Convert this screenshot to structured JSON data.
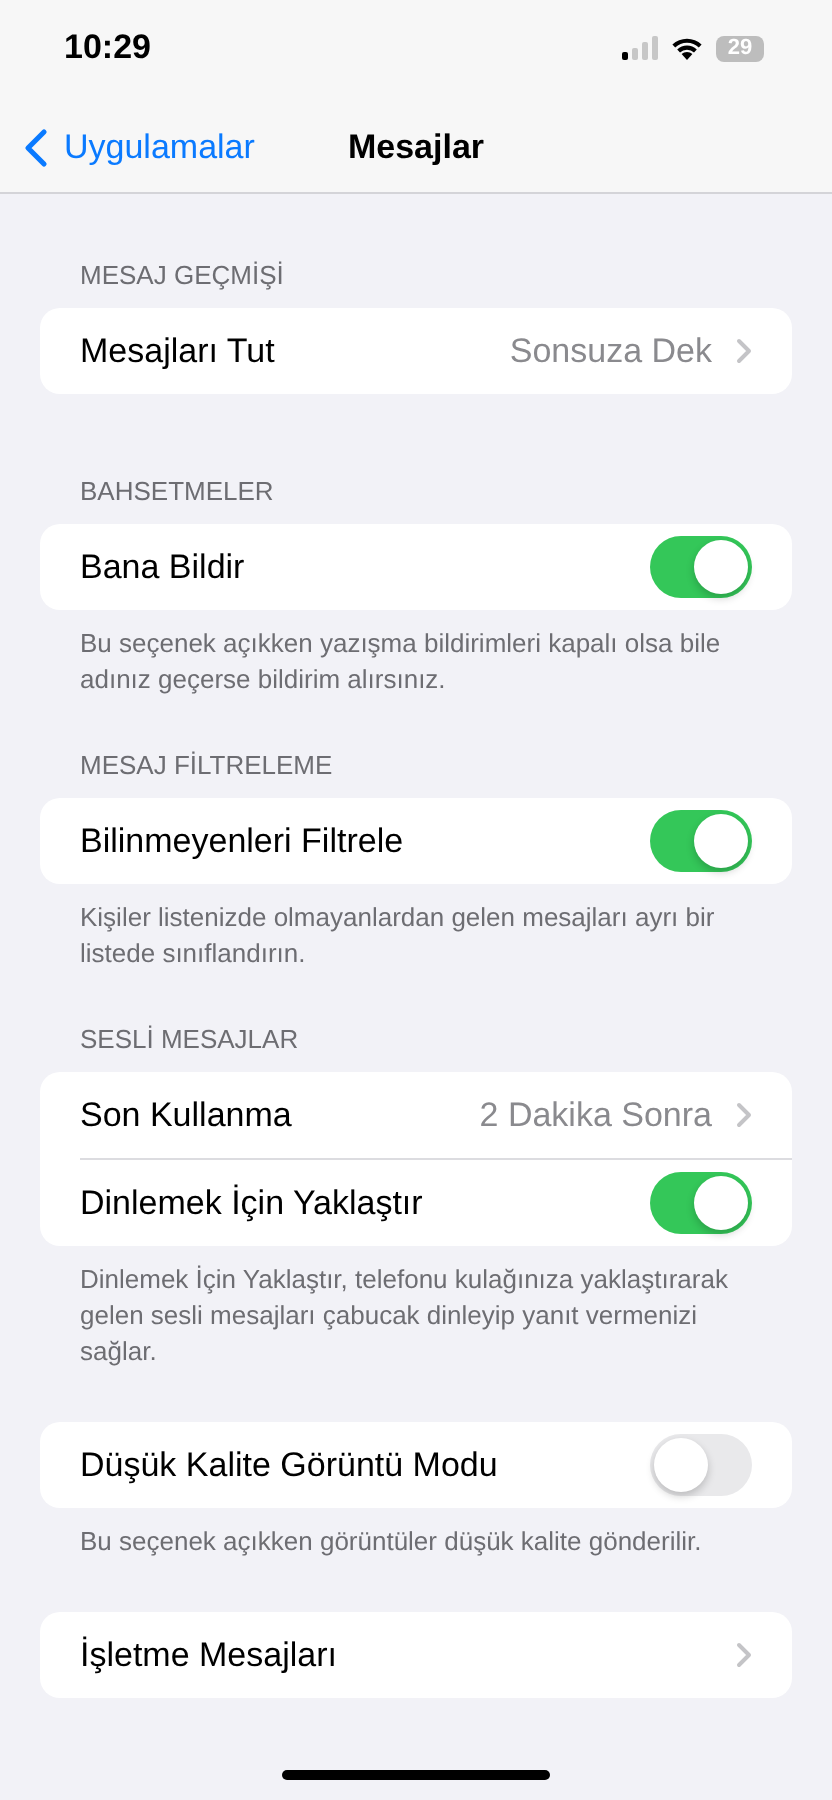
{
  "status_bar": {
    "time": "10:29",
    "battery": "29"
  },
  "nav": {
    "back": "Uygulamalar",
    "title": "Mesajlar"
  },
  "sections": [
    {
      "header": "MESAJ GEÇMİŞİ",
      "rows": [
        {
          "kind": "value",
          "label": "Mesajları Tut",
          "value": "Sonsuza Dek"
        }
      ]
    },
    {
      "header": "BAHSETMELER",
      "rows": [
        {
          "kind": "toggle",
          "label": "Bana Bildir",
          "on": true
        }
      ],
      "footer": "Bu seçenek açıkken yazışma bildirimleri kapalı olsa bile adınız geçerse bildirim alırsınız."
    },
    {
      "header": "MESAJ FİLTRELEME",
      "rows": [
        {
          "kind": "toggle",
          "label": "Bilinmeyenleri Filtrele",
          "on": true
        }
      ],
      "footer": "Kişiler listenizde olmayanlardan gelen mesajları ayrı bir listede sınıflandırın."
    },
    {
      "header": "SESLİ MESAJLAR",
      "rows": [
        {
          "kind": "value",
          "label": "Son Kullanma",
          "value": "2 Dakika Sonra"
        },
        {
          "kind": "toggle",
          "label": "Dinlemek İçin Yaklaştır",
          "on": true
        }
      ],
      "footer": "Dinlemek İçin Yaklaştır, telefonu kulağınıza yaklaştırarak gelen sesli mesajları çabucak dinleyip yanıt vermenizi sağlar."
    },
    {
      "rows": [
        {
          "kind": "toggle",
          "label": "Düşük Kalite Görüntü Modu",
          "on": false
        }
      ],
      "footer": "Bu seçenek açıkken görüntüler düşük kalite gönderilir."
    },
    {
      "rows": [
        {
          "kind": "link",
          "label": "İşletme Mesajları"
        }
      ]
    }
  ]
}
